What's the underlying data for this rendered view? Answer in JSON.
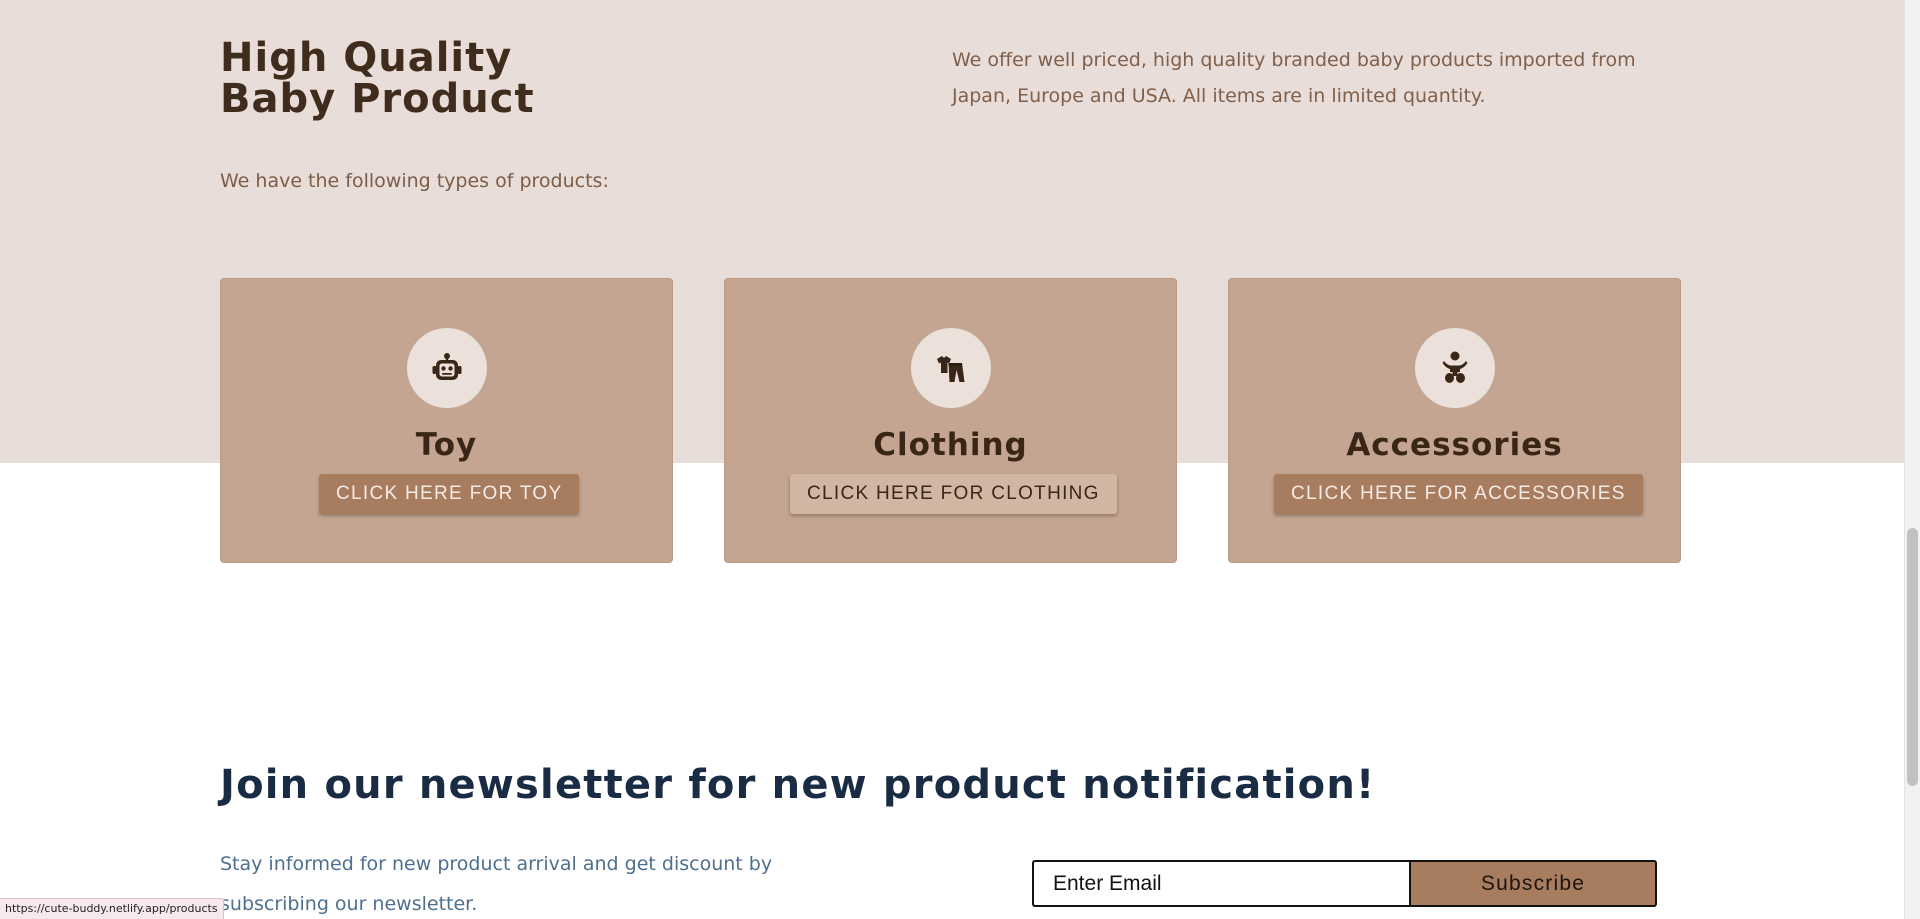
{
  "hero": {
    "title_line1": "High Quality",
    "title_line2": "Baby Product",
    "description": "We offer well priced, high quality branded baby products imported from Japan, Europe and USA. All items are in limited quantity.",
    "types_intro": "We have the following types of products:"
  },
  "categories": [
    {
      "title": "Toy",
      "button_label": "CLICK HERE FOR TOY",
      "icon": "robot-icon"
    },
    {
      "title": "Clothing",
      "button_label": "CLICK HERE FOR CLOTHING",
      "icon": "clothing-icon"
    },
    {
      "title": "Accessories",
      "button_label": "CLICK HERE FOR ACCESSORIES",
      "icon": "baby-icon"
    }
  ],
  "newsletter": {
    "title": "Join our newsletter for new product notification!",
    "description": "Stay informed for new product arrival and get discount by subscribing our newsletter.",
    "email_placeholder": "Enter Email",
    "subscribe_label": "Subscribe"
  },
  "status_bar": {
    "url": "https://cute-buddy.netlify.app/products"
  },
  "colors": {
    "hero_background": "#e8ddd8",
    "card_background": "#c3a591",
    "accent_brown": "#a87c5f",
    "heading_dark_brown": "#3f2c1d",
    "newsletter_heading_navy": "#1a2b44"
  }
}
